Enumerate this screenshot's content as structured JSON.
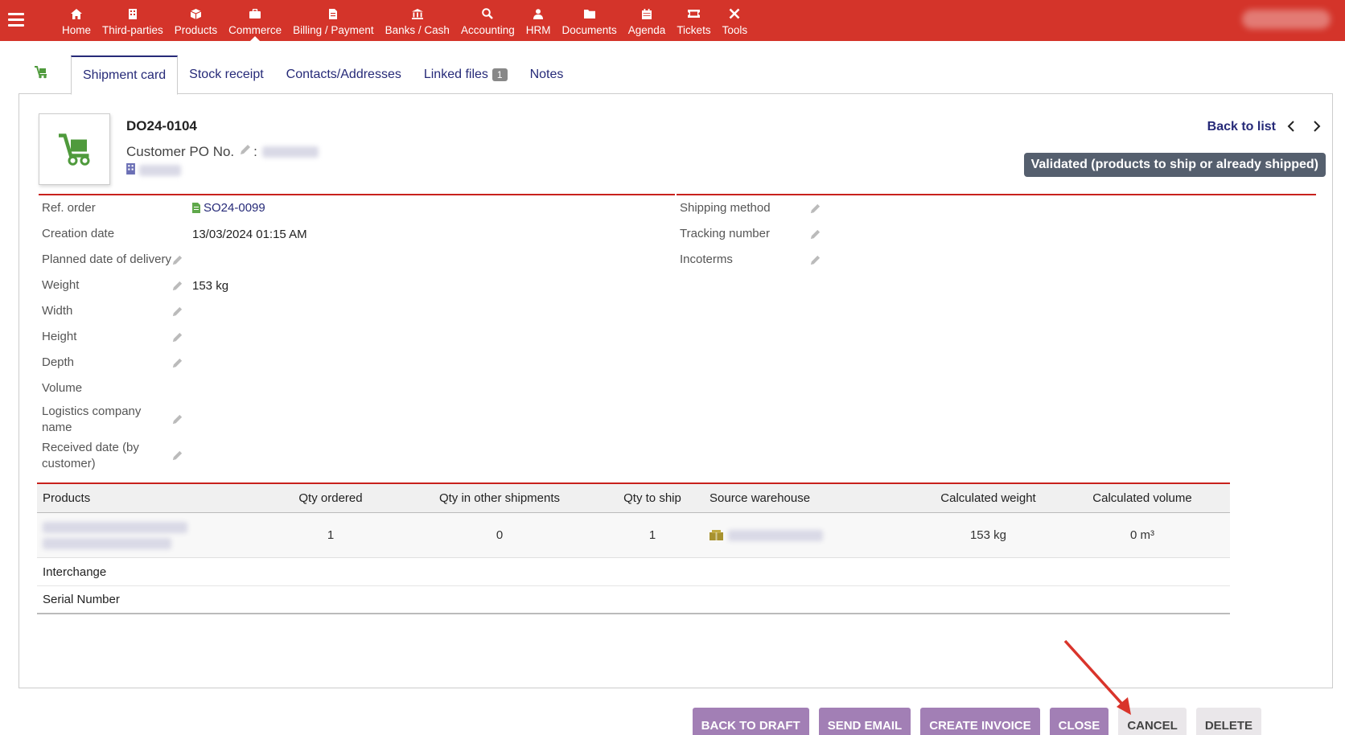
{
  "topbar": {
    "menu": [
      {
        "label": "Home",
        "icon": "home-icon"
      },
      {
        "label": "Third-parties",
        "icon": "building-icon"
      },
      {
        "label": "Products",
        "icon": "cube-icon"
      },
      {
        "label": "Commerce",
        "icon": "briefcase-icon",
        "active": true
      },
      {
        "label": "Billing / Payment",
        "icon": "invoice-icon"
      },
      {
        "label": "Banks / Cash",
        "icon": "bank-icon"
      },
      {
        "label": "Accounting",
        "icon": "search-dollar-icon"
      },
      {
        "label": "HRM",
        "icon": "user-tie-icon"
      },
      {
        "label": "Documents",
        "icon": "folder-icon"
      },
      {
        "label": "Agenda",
        "icon": "calendar-icon"
      },
      {
        "label": "Tickets",
        "icon": "ticket-icon"
      },
      {
        "label": "Tools",
        "icon": "tools-icon"
      }
    ]
  },
  "tabs": [
    {
      "label": "Shipment card",
      "active": true
    },
    {
      "label": "Stock receipt"
    },
    {
      "label": "Contacts/Addresses"
    },
    {
      "label": "Linked files",
      "badge": "1"
    },
    {
      "label": "Notes"
    }
  ],
  "header": {
    "ref": "DO24-0104",
    "customer_po_label": "Customer PO No.",
    "customer_po_sep": ":",
    "back_to_list": "Back to list",
    "status": "Validated (products to ship or already shipped)"
  },
  "fields_left": [
    {
      "label": "Ref. order",
      "value": "SO24-0099"
    },
    {
      "label": "Creation date",
      "value": "13/03/2024 01:15 AM"
    },
    {
      "label": "Planned date of delivery",
      "value": ""
    },
    {
      "label": "Weight",
      "value": "153 kg"
    },
    {
      "label": "Width",
      "value": ""
    },
    {
      "label": "Height",
      "value": ""
    },
    {
      "label": "Depth",
      "value": ""
    },
    {
      "label": "Volume",
      "value": ""
    },
    {
      "label": "Logistics company name",
      "value": ""
    },
    {
      "label": "Received date (by customer)",
      "value": ""
    }
  ],
  "fields_right": [
    {
      "label": "Shipping method",
      "value": ""
    },
    {
      "label": "Tracking number",
      "value": ""
    },
    {
      "label": "Incoterms",
      "value": ""
    }
  ],
  "products": {
    "columns": [
      "Products",
      "Qty ordered",
      "Qty in other shipments",
      "Qty to ship",
      "Source warehouse",
      "Calculated weight",
      "Calculated volume"
    ],
    "row": {
      "qty_ordered": "1",
      "qty_other": "0",
      "qty_to_ship": "1",
      "weight": "153 kg",
      "volume": "0 m³"
    },
    "extra_rows": [
      "Interchange",
      "Serial Number"
    ]
  },
  "actions": {
    "back_to_draft": "Back to draft",
    "send_email": "Send email",
    "create_invoice": "Create invoice",
    "close": "Close",
    "cancel": "Cancel",
    "delete": "Delete"
  },
  "colors": {
    "topbar": "#d4342a",
    "link": "#262a78",
    "accent_line": "#c8211c",
    "action_button": "#a27fb5",
    "status_badge": "#555f6e"
  }
}
